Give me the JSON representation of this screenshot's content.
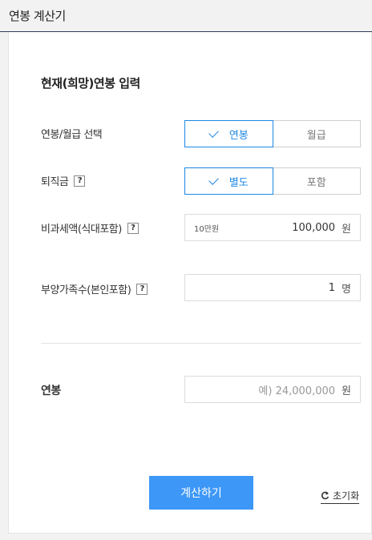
{
  "header": {
    "title": "연봉 계산기"
  },
  "section": {
    "title": "현재(희망)연봉 입력"
  },
  "salary_type": {
    "label": "연봉/월급 선택",
    "options": [
      "연봉",
      "월급"
    ],
    "selected": "연봉"
  },
  "severance": {
    "label": "퇴직금",
    "options": [
      "별도",
      "포함"
    ],
    "selected": "별도",
    "help": "?"
  },
  "nontax": {
    "label": "비과세액(식대포함)",
    "help": "?",
    "hint": "10만원",
    "value": "100,000",
    "unit": "원"
  },
  "dependents": {
    "label": "부양가족수(본인포함)",
    "help": "?",
    "value": "1",
    "unit": "명"
  },
  "annual": {
    "label": "연봉",
    "placeholder": "예) 24,000,000",
    "unit": "원"
  },
  "actions": {
    "calculate": "계산하기",
    "reset": "초기화"
  }
}
